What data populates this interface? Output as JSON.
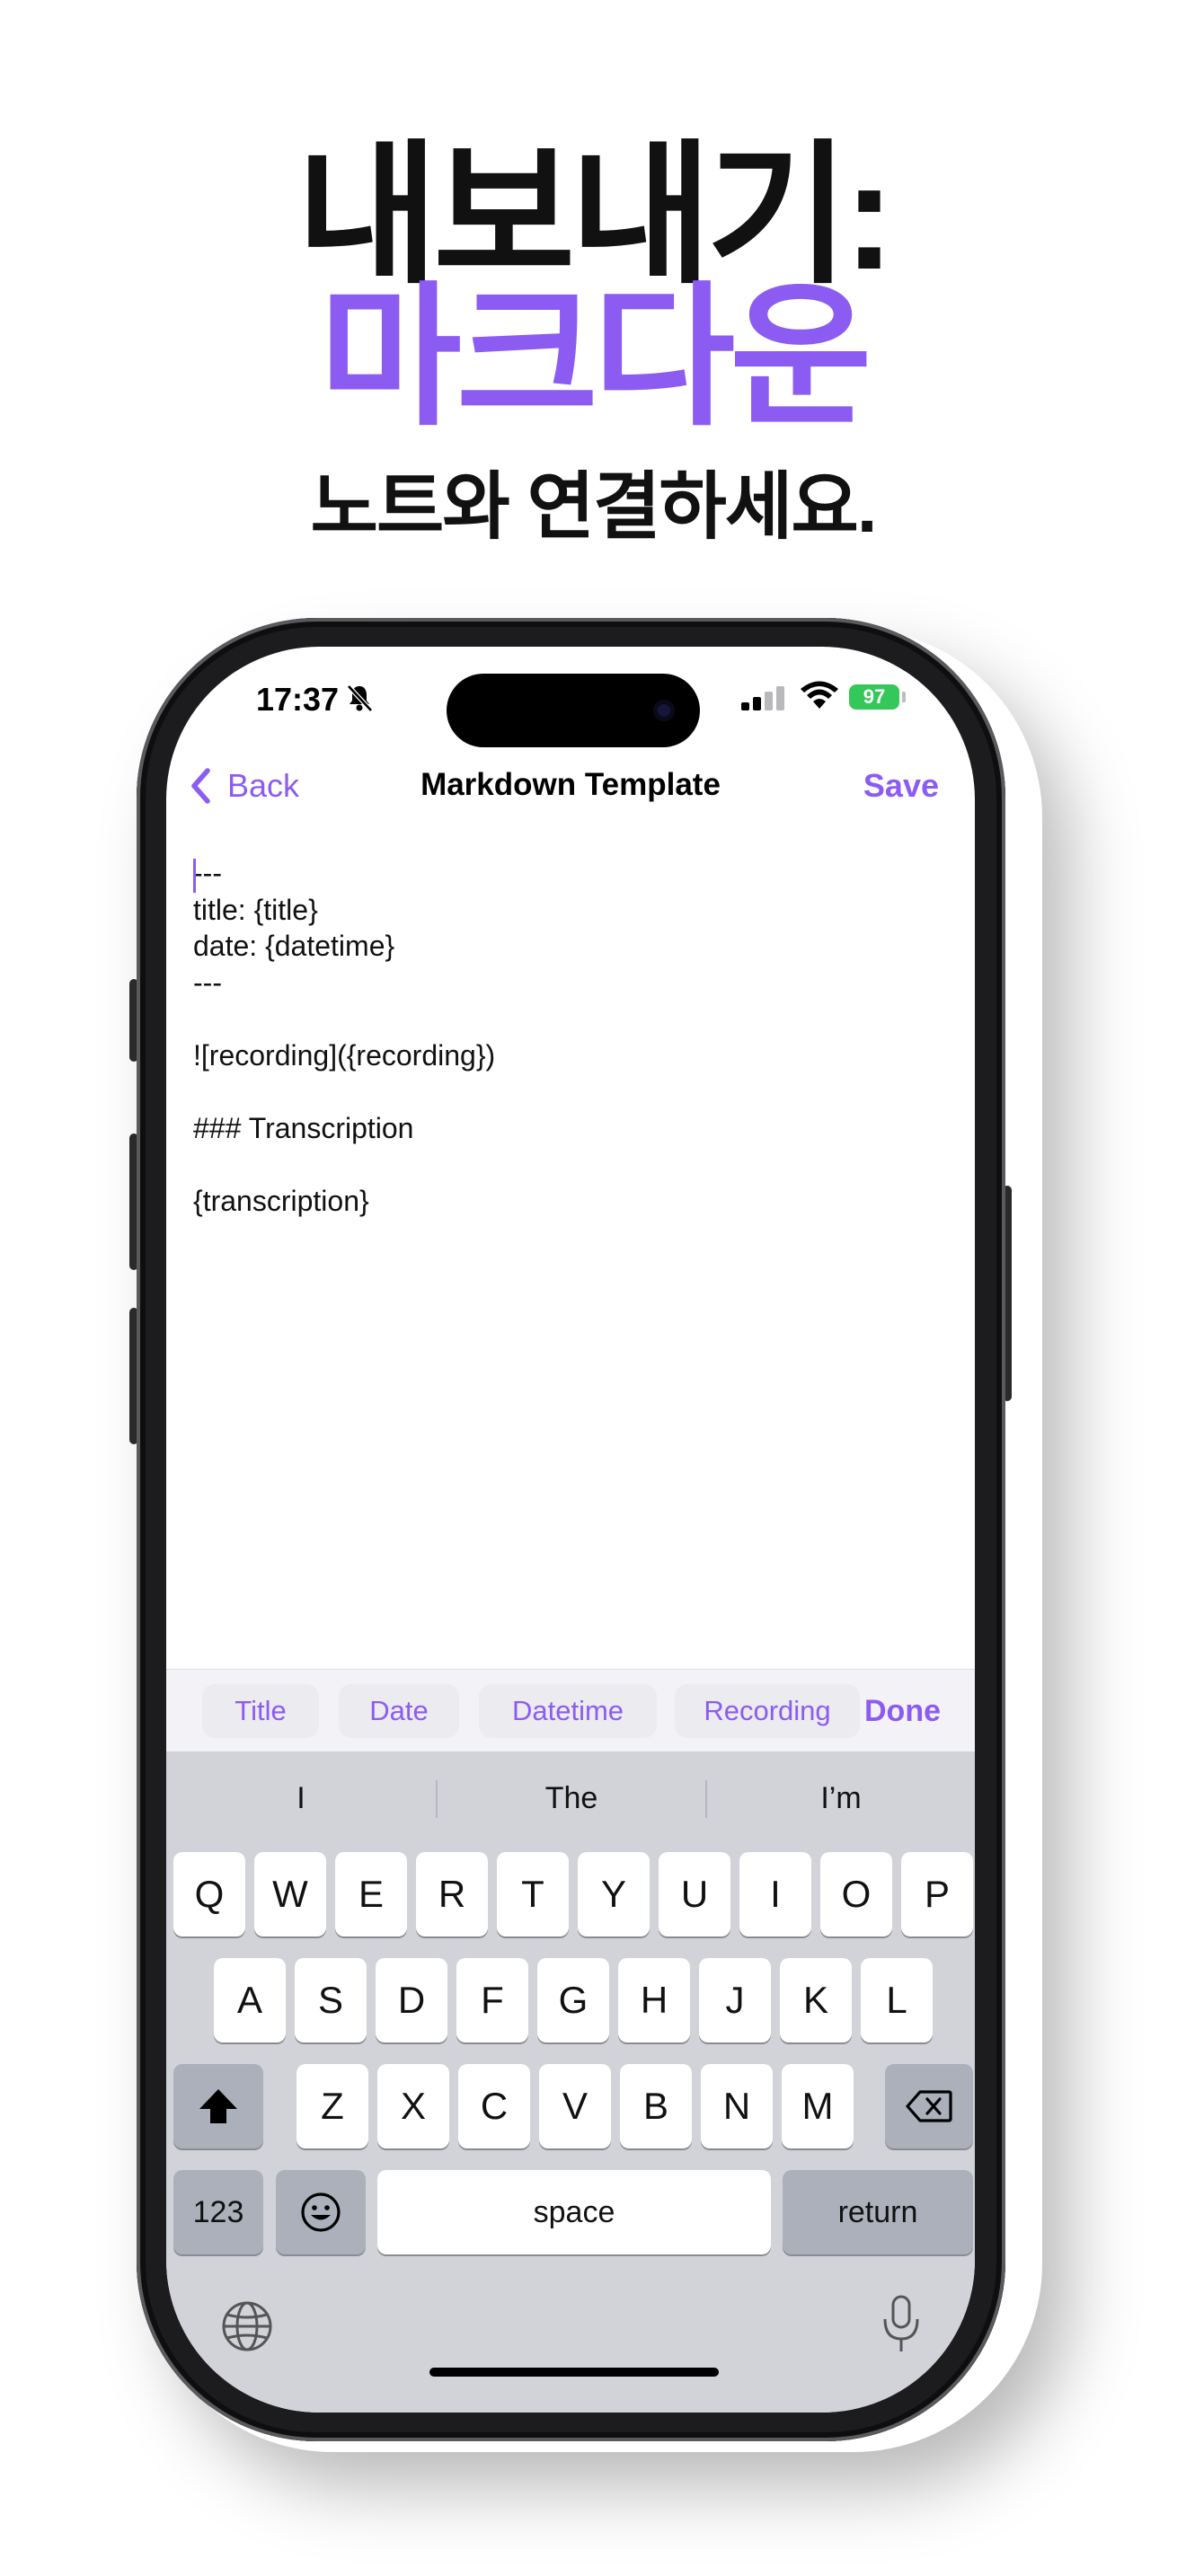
{
  "headline": {
    "line1": "내보내기:",
    "line2": "마크다운",
    "subtitle": "노트와 연결하세요."
  },
  "colors": {
    "accent": "#8c5cf2",
    "battery": "#34c759",
    "keyboard_bg": "#d1d3d9"
  },
  "status_bar": {
    "time": "17:37",
    "battery": "97"
  },
  "nav": {
    "back_label": "Back",
    "title": "Markdown Template",
    "save_label": "Save"
  },
  "editor": {
    "lines": [
      "---",
      "title: {title}",
      "date: {datetime}",
      "---",
      "",
      "![recording]({recording})",
      "",
      "### Transcription",
      "",
      "{transcription}"
    ]
  },
  "accessory": {
    "chips": [
      "Title",
      "Date",
      "Datetime",
      "Recording"
    ],
    "done_label": "Done"
  },
  "keyboard": {
    "suggestions": [
      "I",
      "The",
      "I’m"
    ],
    "row1": [
      "Q",
      "W",
      "E",
      "R",
      "T",
      "Y",
      "U",
      "I",
      "O",
      "P"
    ],
    "row2": [
      "A",
      "S",
      "D",
      "F",
      "G",
      "H",
      "J",
      "K",
      "L"
    ],
    "row3": [
      "Z",
      "X",
      "C",
      "V",
      "B",
      "N",
      "M"
    ],
    "numbers_label": "123",
    "space_label": "space",
    "return_label": "return"
  }
}
